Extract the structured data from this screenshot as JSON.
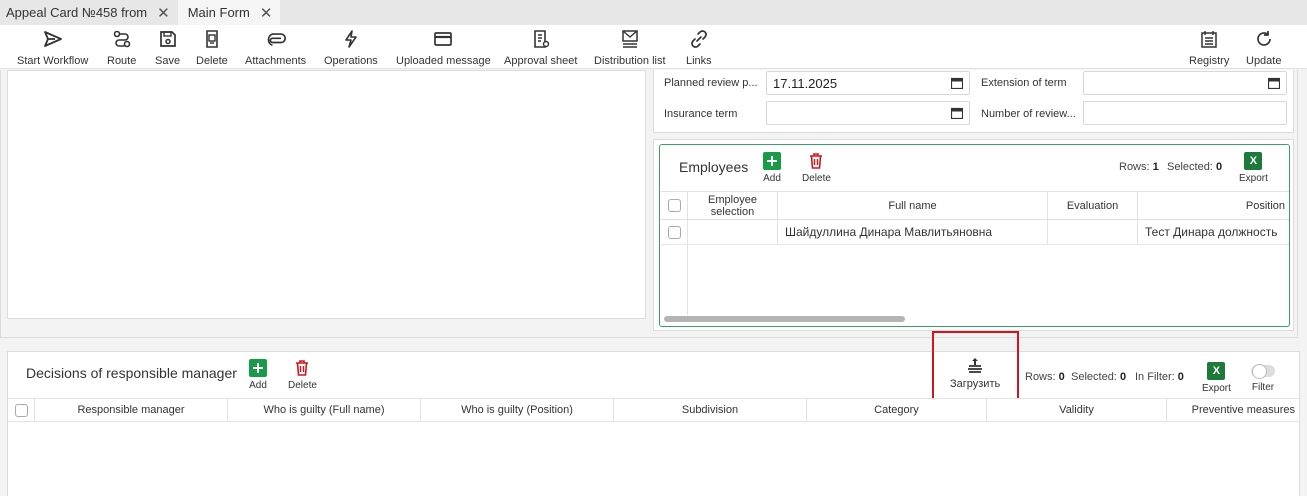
{
  "tabs": [
    {
      "label": "Appeal Card №458 from"
    },
    {
      "label": "Main Form"
    }
  ],
  "toolbar": {
    "start_workflow": "Start Workflow",
    "route": "Route",
    "save": "Save",
    "delete": "Delete",
    "attachments": "Attachments",
    "operations": "Operations",
    "uploaded_message": "Uploaded message",
    "approval_sheet": "Approval sheet",
    "distribution_list": "Distribution list",
    "links": "Links",
    "registry": "Registry",
    "update": "Update"
  },
  "form": {
    "planned_review_label": "Planned review p...",
    "planned_review_value": "17.11.2025",
    "extension_label": "Extension of term",
    "extension_value": "",
    "insurance_label": "Insurance term",
    "insurance_value": "",
    "number_review_label": "Number of review...",
    "number_review_value": ""
  },
  "employees": {
    "title": "Employees",
    "add": "Add",
    "delete": "Delete",
    "rows_label": "Rows:",
    "rows_value": "1",
    "selected_label": "Selected:",
    "selected_value": "0",
    "export": "Export",
    "columns": [
      "Employee selection",
      "Full name",
      "Evaluation",
      "Position"
    ],
    "rows": [
      {
        "full_name": "Шайдуллина Динара Мавлитьяновна",
        "evaluation": "",
        "position": "Тест Динара должность"
      }
    ]
  },
  "decisions": {
    "title": "Decisions of responsible manager",
    "add": "Add",
    "delete": "Delete",
    "upload": "Загрузить",
    "rows_label": "Rows:",
    "rows_value": "0",
    "selected_label": "Selected:",
    "selected_value": "0",
    "filter_label": "In Filter:",
    "filter_value": "0",
    "export": "Export",
    "filter": "Filter",
    "columns": [
      "Responsible manager",
      "Who is guilty (Full name)",
      "Who is guilty (Position)",
      "Subdivision",
      "Category",
      "Validity",
      "Preventive measures"
    ]
  },
  "colors": {
    "accent_green": "#1a9b47",
    "delete_red": "#d0161c",
    "excel_green": "#1d7a3a"
  }
}
